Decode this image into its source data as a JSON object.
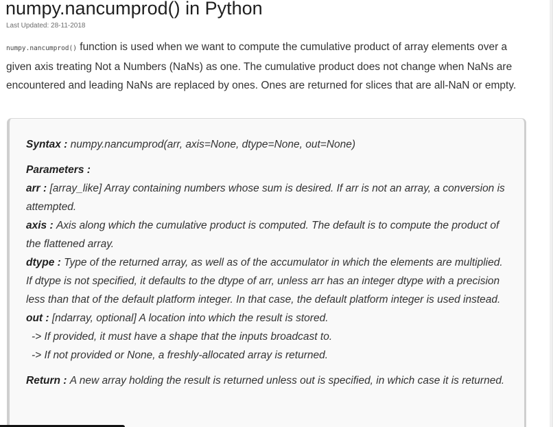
{
  "article": {
    "title": "numpy.nancumprod() in Python",
    "last_updated": "Last Updated: 28-11-2018",
    "intro_code": "numpy.nancumprod()",
    "intro_text": " function is used when we want to compute the cumulative product of array elements over a given axis treating Not a Numbers (NaNs) as one. The cumulative product does not change when NaNs are encountered and leading NaNs are replaced by ones. Ones are returned for slices that are all-NaN or empty."
  },
  "syntax_box": {
    "syntax_label": "Syntax : ",
    "syntax_value": "numpy.nancumprod(arr, axis=None, dtype=None, out=None)",
    "parameters_label": "Parameters :",
    "arr_label": "arr : ",
    "arr_desc": "[array_like] Array containing numbers whose sum is desired. If arr is not an array, a conversion is attempted.",
    "axis_label": "axis : ",
    "axis_desc": "Axis along which the cumulative product is computed. The default is to compute the product of the flattened array.",
    "dtype_label": "dtype : ",
    "dtype_desc": "Type of the returned array, as well as of the accumulator in which the elements are multiplied. If dtype is not specified, it defaults to the dtype of arr, unless arr has an integer dtype with a precision less than that of the default platform integer. In that case, the default platform integer is used instead.",
    "out_label": "out : ",
    "out_desc": "[ndarray, optional] A location into which the result is stored.",
    "out_sub_1": "-> If provided, it must have a shape that the inputs broadcast to.",
    "out_sub_2": "-> If not provided or None, a freshly-allocated array is returned.",
    "return_label": "Return : ",
    "return_desc": "A new array holding the result is returned unless out is specified, in which case it is returned."
  }
}
